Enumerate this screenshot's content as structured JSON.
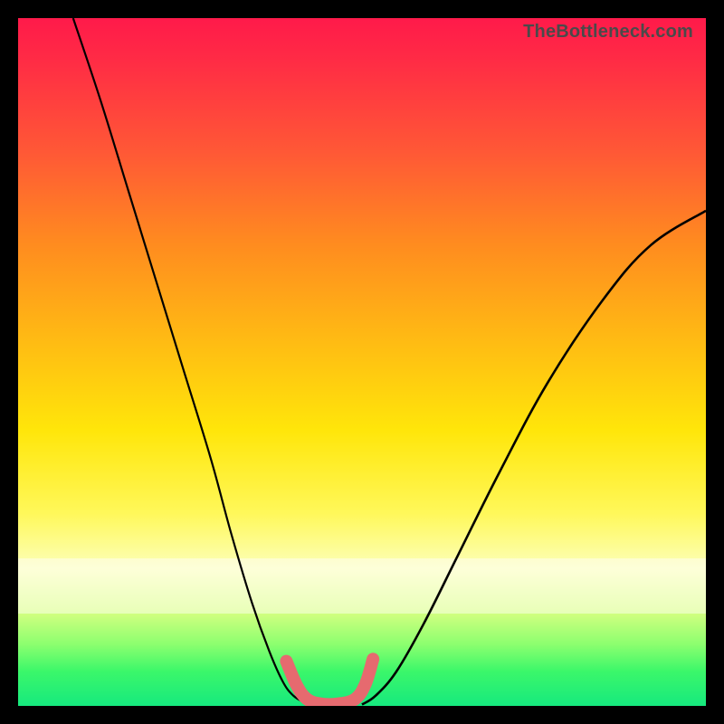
{
  "watermark": "TheBottleneck.com",
  "chart_data": {
    "type": "line",
    "title": "",
    "xlabel": "",
    "ylabel": "",
    "xlim": [
      0,
      100
    ],
    "ylim": [
      0,
      100
    ],
    "series": [
      {
        "name": "left-curve",
        "x": [
          8,
          12,
          16,
          20,
          24,
          28,
          31,
          34,
          36.5,
          38.5,
          40,
          41.5,
          43
        ],
        "y": [
          100,
          88,
          75,
          62,
          49,
          36,
          25,
          15,
          8,
          3.5,
          1.5,
          0.6,
          0.2
        ]
      },
      {
        "name": "right-curve",
        "x": [
          50,
          52,
          55,
          59,
          64,
          70,
          77,
          85,
          92,
          100
        ],
        "y": [
          0.2,
          1.5,
          5,
          12,
          22,
          34,
          47,
          59,
          67,
          72
        ]
      },
      {
        "name": "floor-marker",
        "x": [
          39,
          40.5,
          42,
          44,
          46.5,
          49,
          50.5,
          51.6
        ],
        "y": [
          6.5,
          3,
          1,
          0.3,
          0.3,
          1,
          3.2,
          6.8
        ]
      }
    ]
  }
}
